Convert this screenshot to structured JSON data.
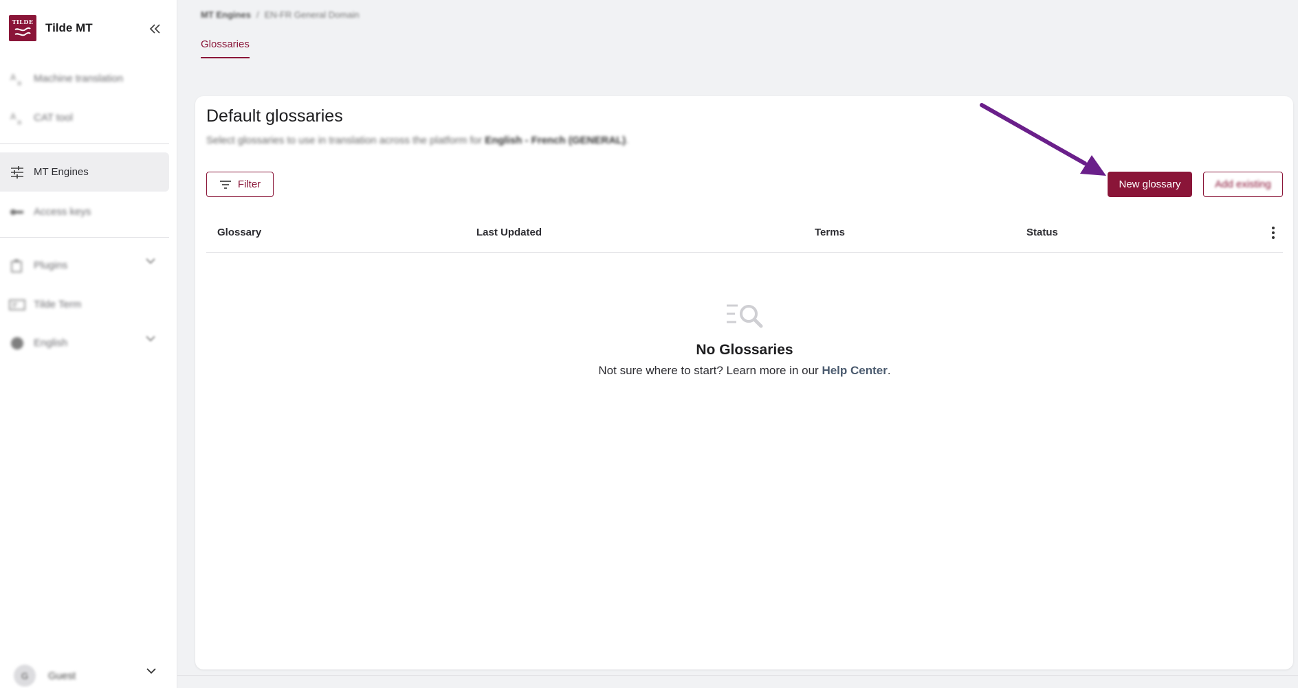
{
  "app": {
    "name": "Tilde MT",
    "logo_text": "TILDE"
  },
  "sidebar": {
    "items": [
      {
        "label": "Machine translation",
        "icon": "translate-icon"
      },
      {
        "label": "CAT tool",
        "icon": "cat-tool-icon"
      },
      {
        "label": "MT Engines",
        "icon": "sliders-icon"
      },
      {
        "label": "Access keys",
        "icon": "key-icon"
      },
      {
        "label": "Plugins",
        "icon": "plugin-icon"
      },
      {
        "label": "Tilde Term",
        "icon": "term-icon"
      },
      {
        "label": "English",
        "icon": "globe-icon"
      }
    ],
    "user": {
      "initial": "G",
      "name": "Guest"
    }
  },
  "header": {
    "breadcrumb": [
      "MT Engines",
      "EN-FR General Domain"
    ],
    "tab": "Glossaries"
  },
  "card": {
    "title": "Default glossaries",
    "subtitle": "Select glossaries to use in translation across the platform for",
    "subtitle_bold": "English - French (GENERAL)",
    "subtitle_end": ".",
    "filter_label": "Filter",
    "new_label": "New glossary",
    "add_label": "Add existing"
  },
  "table": {
    "columns": [
      "Glossary",
      "Last Updated",
      "Terms",
      "Status"
    ]
  },
  "empty": {
    "title": "No Glossaries",
    "text": "Not sure where to start? Learn more in our",
    "link": "Help Center",
    "text_end": "."
  },
  "colors": {
    "brand": "#8a1538",
    "annotation_arrow": "#6a1f8a"
  }
}
